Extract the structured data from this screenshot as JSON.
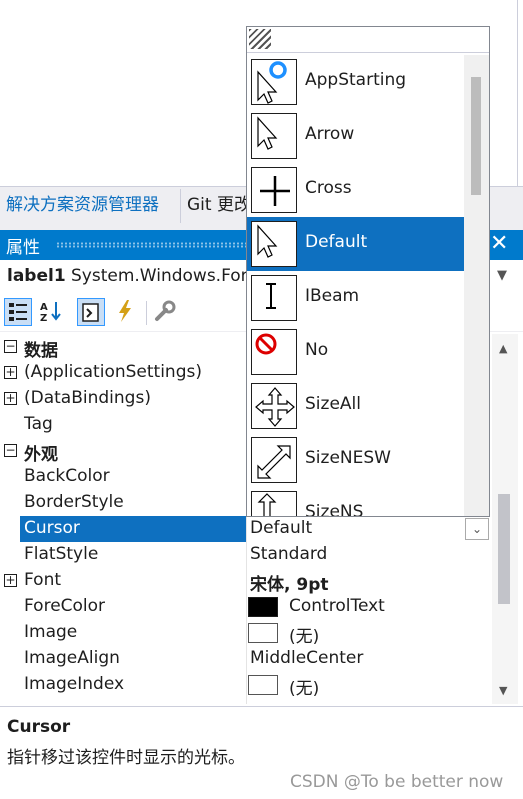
{
  "doc_tabs": [
    {
      "label": "解决方案资源管理器"
    },
    {
      "label": "Git 更改"
    }
  ],
  "properties_panel": {
    "title": "属性",
    "close_glyph": "✕",
    "object_name": "label1",
    "object_type": "System.Windows.Forms.Label",
    "toolbar": [
      {
        "name": "categorized-icon",
        "selected": true
      },
      {
        "name": "alphabetical-icon",
        "selected": false
      },
      {
        "name": "properties-icon",
        "selected": true
      },
      {
        "name": "events-icon",
        "selected": false
      },
      {
        "name": "property-pages-icon",
        "selected": false
      }
    ]
  },
  "grid": {
    "rows": [
      {
        "kind": "category",
        "expander": "⊟",
        "name": "数据"
      },
      {
        "kind": "prop",
        "expander": "⊞",
        "name": "(ApplicationSettings)",
        "value": ""
      },
      {
        "kind": "prop",
        "expander": "⊞",
        "name": "(DataBindings)",
        "value": ""
      },
      {
        "kind": "prop",
        "name": "Tag",
        "value": ""
      },
      {
        "kind": "category",
        "expander": "⊟",
        "name": "外观"
      },
      {
        "kind": "prop",
        "name": "BackColor",
        "value": ""
      },
      {
        "kind": "prop",
        "name": "BorderStyle",
        "value": ""
      },
      {
        "kind": "prop",
        "name": "Cursor",
        "value": "Default",
        "selected": true
      },
      {
        "kind": "prop",
        "name": "FlatStyle",
        "value": "Standard"
      },
      {
        "kind": "prop",
        "expander": "⊞",
        "name": "Font",
        "value": "宋体, 9pt",
        "bold": true
      },
      {
        "kind": "prop",
        "name": "ForeColor",
        "value": "ControlText",
        "swatch": "#000000"
      },
      {
        "kind": "prop",
        "name": "Image",
        "value": "(无)",
        "swatch": "#ffffff"
      },
      {
        "kind": "prop",
        "name": "ImageAlign",
        "value": "MiddleCenter"
      },
      {
        "kind": "prop",
        "name": "ImageIndex",
        "value": "(无)",
        "swatch": "#ffffff"
      }
    ]
  },
  "cursor_dropdown": {
    "selected": "Default",
    "items": [
      {
        "label": "AppStarting",
        "icon": "appstarting-cursor-icon"
      },
      {
        "label": "Arrow",
        "icon": "arrow-cursor-icon"
      },
      {
        "label": "Cross",
        "icon": "cross-cursor-icon"
      },
      {
        "label": "Default",
        "icon": "default-cursor-icon"
      },
      {
        "label": "IBeam",
        "icon": "ibeam-cursor-icon"
      },
      {
        "label": "No",
        "icon": "no-cursor-icon"
      },
      {
        "label": "SizeAll",
        "icon": "sizeall-cursor-icon"
      },
      {
        "label": "SizeNESW",
        "icon": "sizenesw-cursor-icon"
      },
      {
        "label": "SizeNS",
        "icon": "sizens-cursor-icon"
      }
    ]
  },
  "description": {
    "title": "Cursor",
    "text": "指针移过该控件时显示的光标。"
  },
  "watermark": "CSDN @To be better now",
  "colors": {
    "accent": "#007acc",
    "selection": "#0e70c0",
    "link_tab": "#0e70c0"
  }
}
